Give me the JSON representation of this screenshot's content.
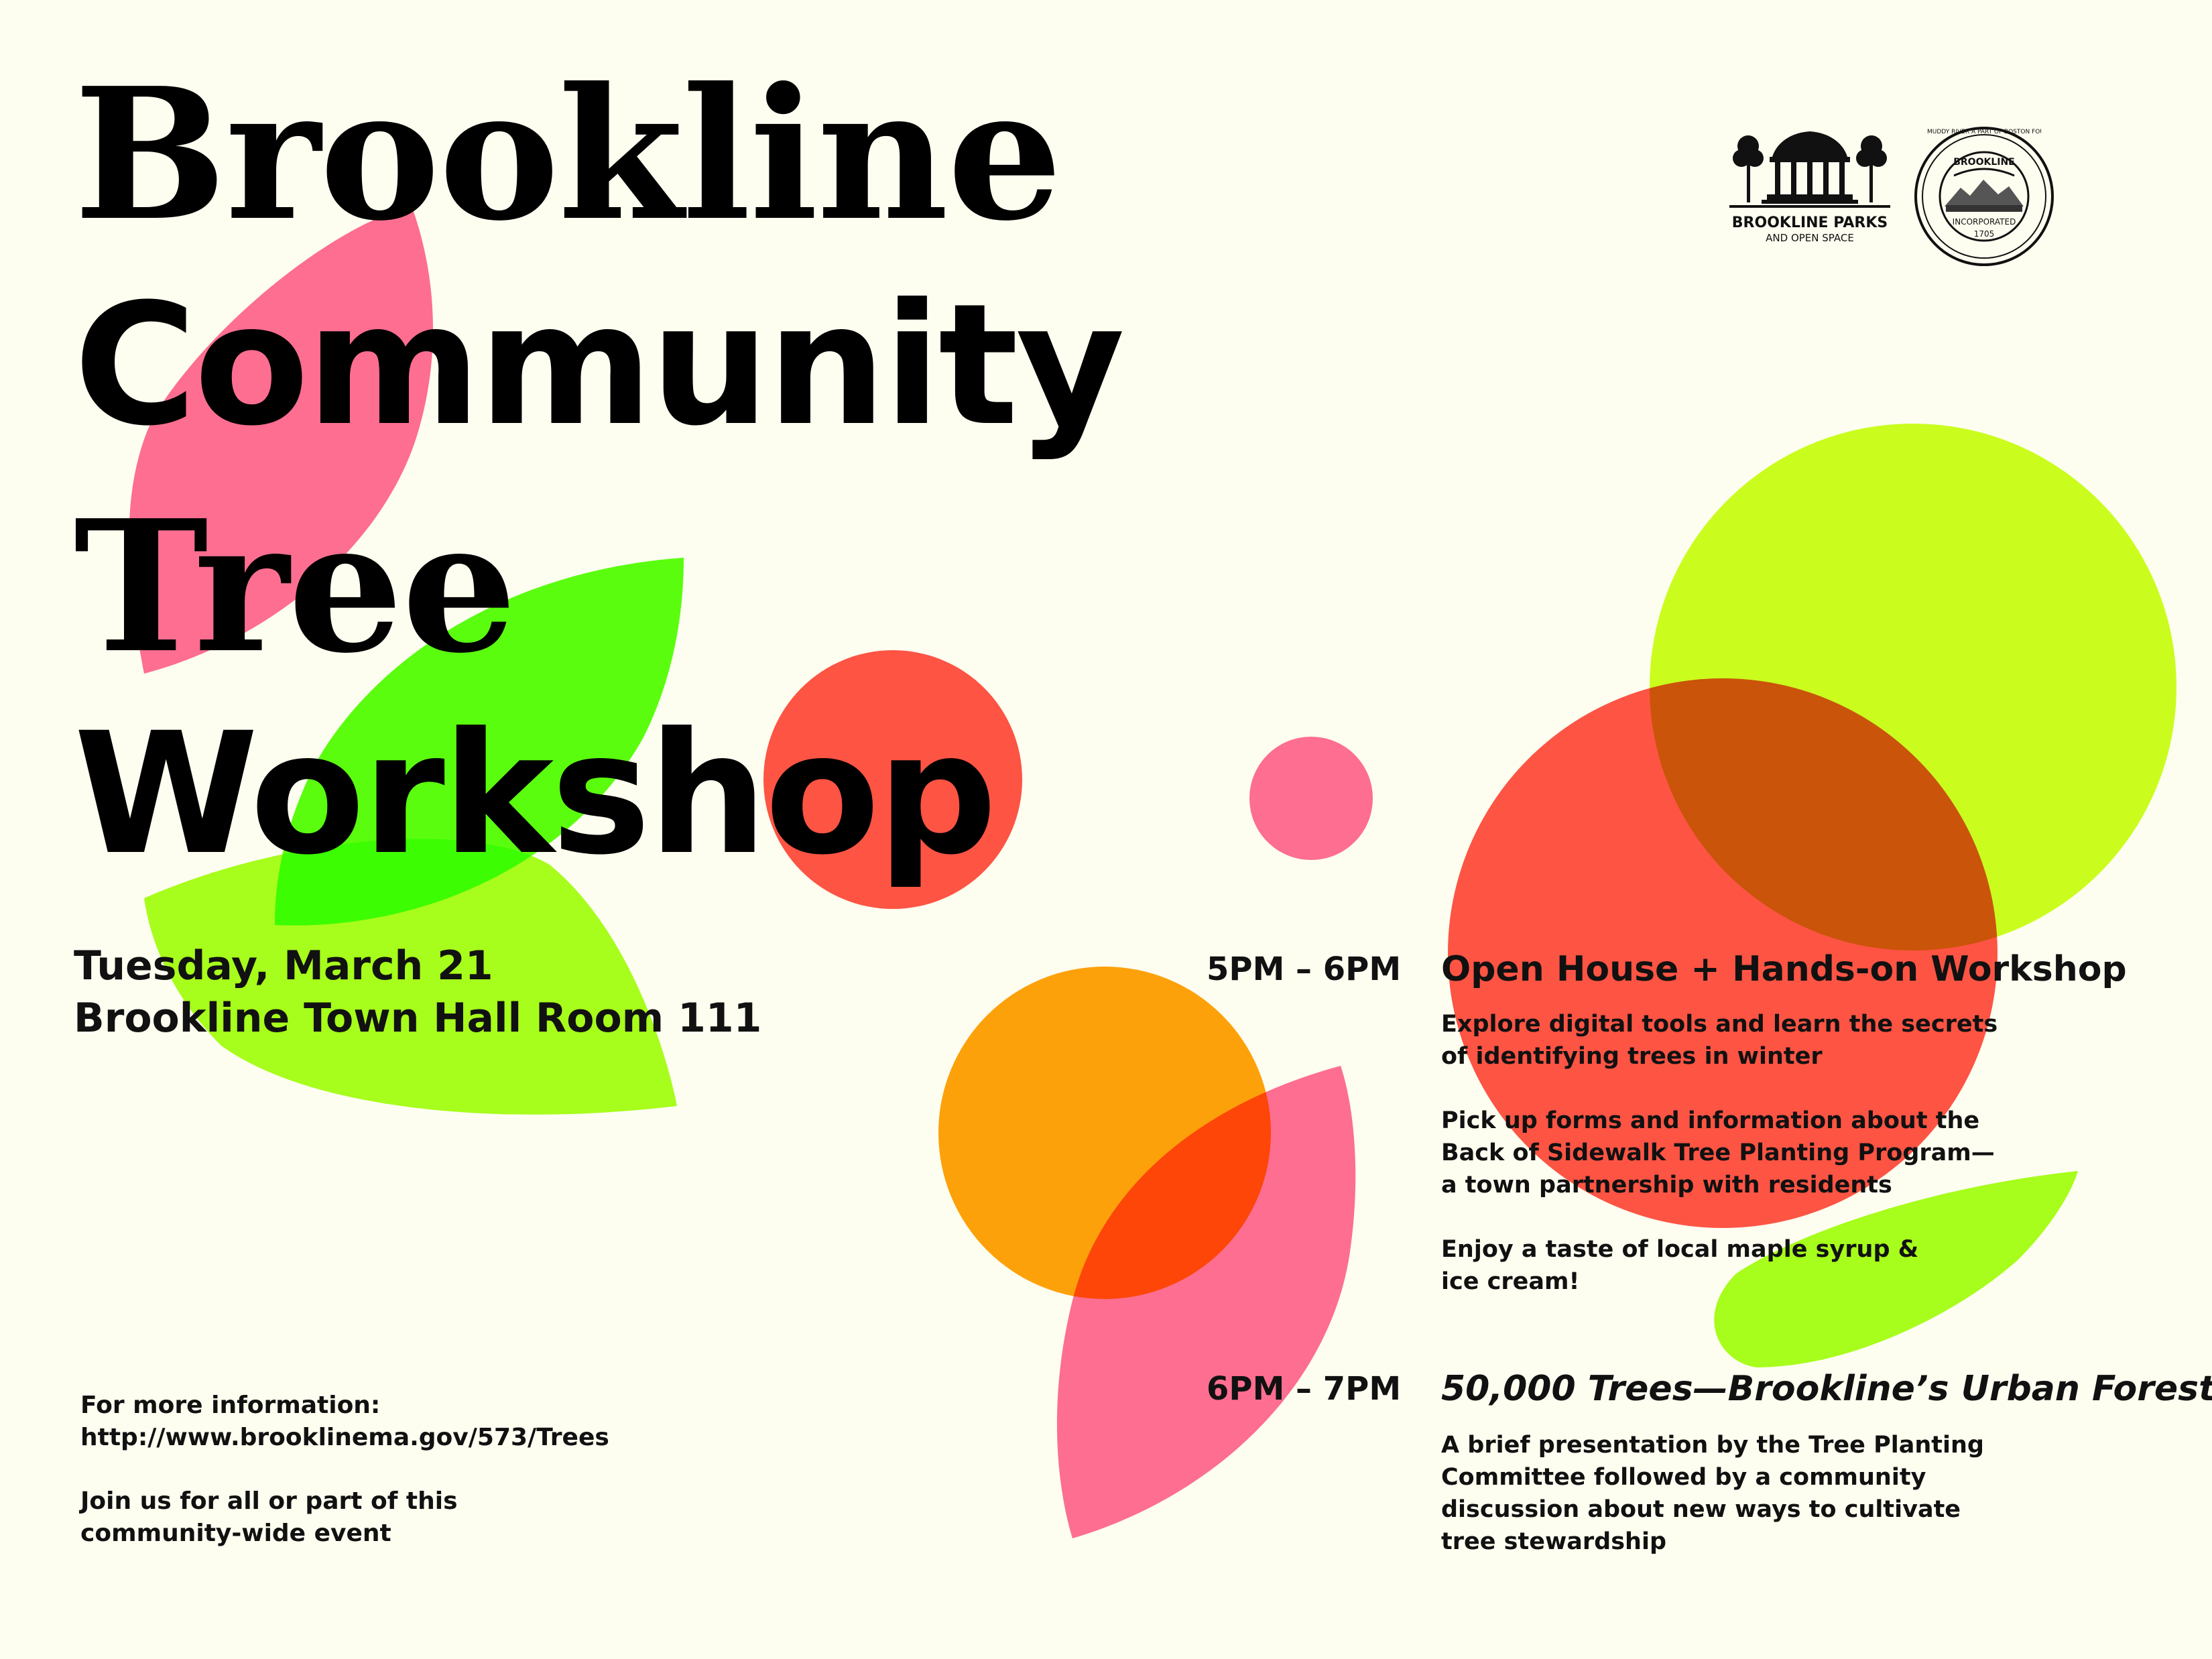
{
  "title": {
    "line1": "Brookline",
    "line2": "Community",
    "line3": "Tree",
    "line4": "Workshop"
  },
  "event": {
    "date": "Tuesday, March 21",
    "location": "Brookline Town Hall Room 111"
  },
  "more_info": {
    "label": "For more information:",
    "url": "http://www.brooklinema.gov/573/Trees",
    "join_line1": "Join us for all or part of this",
    "join_line2": "community-wide event"
  },
  "sessions": [
    {
      "time": "5PM – 6PM",
      "title": "Open House + Hands-on Workshop",
      "paragraphs": [
        "Explore digital tools and learn the secrets\nof identifying trees in winter",
        "Pick up forms and information about the\nBack of Sidewalk Tree Planting Program—\na town partnership with residents",
        "Enjoy a taste of local maple syrup &\nice cream!"
      ]
    },
    {
      "time": "6PM – 7PM",
      "title": "50,000 Trees—Brookline’s Urban Forest",
      "paragraphs": [
        "A brief presentation by the Tree Planting\nCommittee followed by a community\ndiscussion about new ways to cultivate\ntree stewardship"
      ]
    }
  ],
  "logos": {
    "parks_line1": "BROOKLINE PARKS",
    "parks_line2": "AND OPEN SPACE",
    "seal_center": "BROOKLINE",
    "seal_incorporated": "INCORPORATED",
    "seal_year": "1705",
    "seal_ring": "MUDDY RIVER A PART OF BOSTON FOUNDED 1630"
  },
  "colors": {
    "background": "#fdfdf0",
    "pink": "#ff6f9a",
    "green": "#5cff10",
    "lime": "#a8ff1c",
    "red": "#ff5448",
    "orange": "#ffa20a",
    "yellow": "#ccff1f"
  }
}
